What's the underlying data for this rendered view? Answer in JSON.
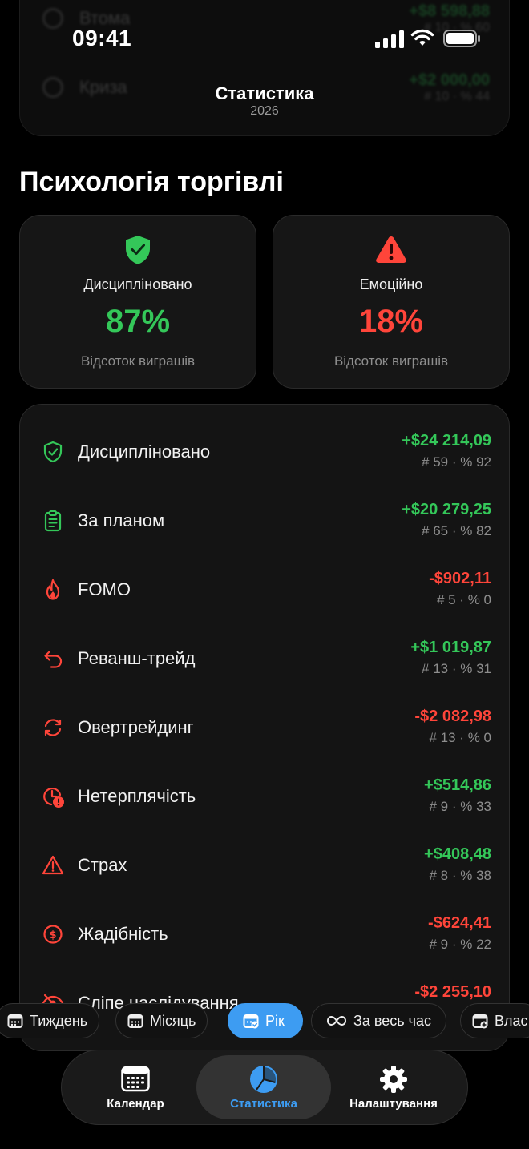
{
  "status_bar": {
    "time": "09:41"
  },
  "header": {
    "title": "Статистика",
    "subtitle": "2026"
  },
  "section_title": "Психологія торгівлі",
  "summary": {
    "disciplined": {
      "label": "Дисципліновано",
      "value": "87%",
      "caption": "Відсоток виграшів",
      "color": "#34c759",
      "icon": "shield-check-icon"
    },
    "emotional": {
      "label": "Емоційно",
      "value": "18%",
      "caption": "Відсоток виграшів",
      "color": "#ff453a",
      "icon": "warning-triangle-icon"
    }
  },
  "stats": [
    {
      "label": "Дисципліновано",
      "amount": "+$24 214,09",
      "meta": "# 59 · % 92",
      "positive": true,
      "icon": "shield-check-icon"
    },
    {
      "label": "За планом",
      "amount": "+$20 279,25",
      "meta": "# 65 · % 82",
      "positive": true,
      "icon": "clipboard-icon"
    },
    {
      "label": "FOMO",
      "amount": "-$902,11",
      "meta": "# 5 · % 0",
      "positive": false,
      "icon": "flame-icon"
    },
    {
      "label": "Реванш-трейд",
      "amount": "+$1 019,87",
      "meta": "# 13 · % 31",
      "positive": true,
      "icon": "return-arrow-icon"
    },
    {
      "label": "Овертрейдинг",
      "amount": "-$2 082,98",
      "meta": "# 13 · % 0",
      "positive": false,
      "icon": "refresh-icon"
    },
    {
      "label": "Нетерплячість",
      "amount": "+$514,86",
      "meta": "# 9 · % 33",
      "positive": true,
      "icon": "clock-alert-icon"
    },
    {
      "label": "Страх",
      "amount": "+$408,48",
      "meta": "# 8 · % 38",
      "positive": true,
      "icon": "warning-triangle-icon"
    },
    {
      "label": "Жадібність",
      "amount": "-$624,41",
      "meta": "# 9 · % 22",
      "positive": false,
      "icon": "dollar-circle-icon"
    },
    {
      "label": "Сліпе наслідування",
      "amount": "-$2 255,10",
      "meta": "",
      "positive": false,
      "icon": "eye-off-icon"
    }
  ],
  "ghost_rows": [
    {
      "label": "Втома",
      "amount": "+$8 598,88",
      "meta": "# 10 · % 60"
    },
    {
      "label": "Криза",
      "amount": "+$2 000,00",
      "meta": "# 10 · % 44"
    }
  ],
  "periods": [
    {
      "label": "Тиждень",
      "active": false
    },
    {
      "label": "Місяць",
      "active": false
    },
    {
      "label": "Рік",
      "active": true
    },
    {
      "label": "За весь час",
      "active": false
    },
    {
      "label": "Влас",
      "active": false
    }
  ],
  "tabs": [
    {
      "label": "Календар",
      "active": false,
      "icon": "calendar-icon"
    },
    {
      "label": "Статистика",
      "active": true,
      "icon": "pie-chart-icon"
    },
    {
      "label": "Налаштування",
      "active": false,
      "icon": "gear-icon"
    }
  ],
  "colors": {
    "positive": "#34c759",
    "negative": "#ff453a",
    "accent": "#3d9cf2"
  }
}
